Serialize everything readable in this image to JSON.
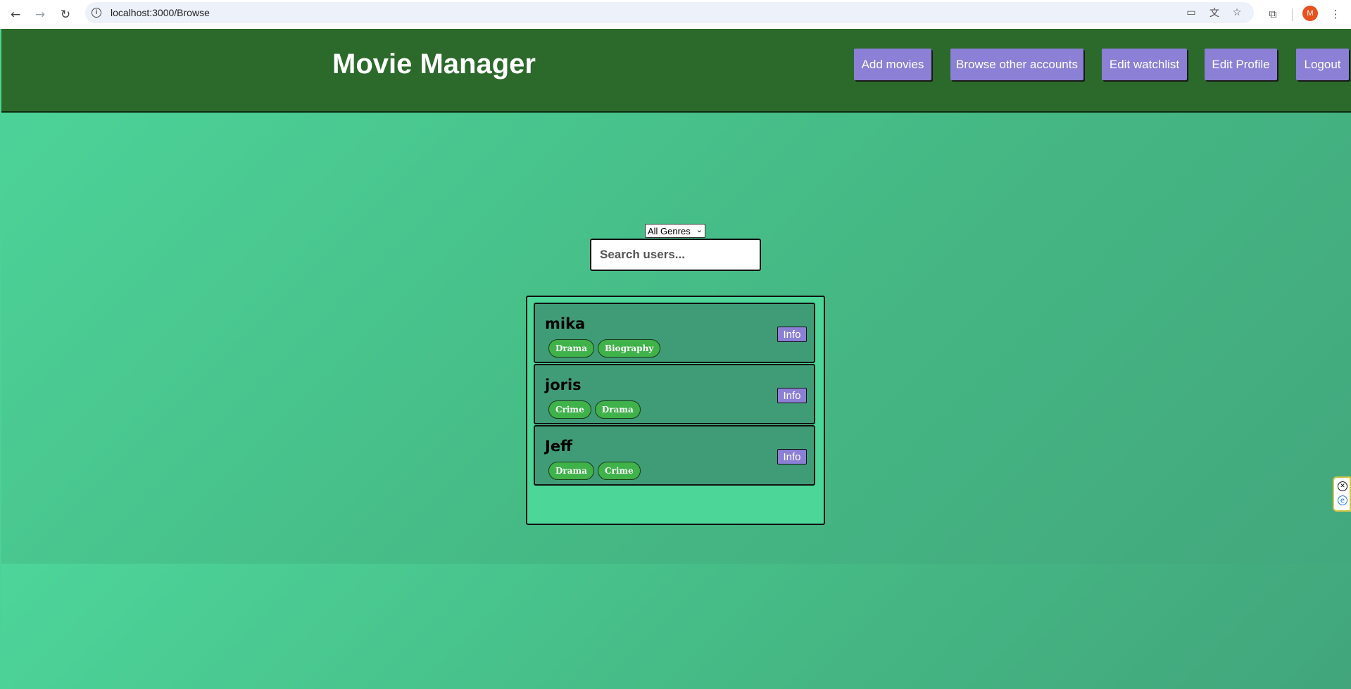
{
  "browser": {
    "url": "localhost:3000/Browse",
    "back_icon": "←",
    "forward_icon": "→",
    "reload_icon": "↻",
    "avatar_letter": "M"
  },
  "header": {
    "title": "Movie Manager",
    "buttons": {
      "add_movies": "Add movies",
      "browse_accounts": "Browse other accounts",
      "edit_watchlist": "Edit watchlist",
      "edit_profile": "Edit Profile",
      "logout": "Logout"
    }
  },
  "filters": {
    "genre_selected": "All Genres",
    "search_placeholder": "Search users..."
  },
  "users": [
    {
      "name": "mika",
      "genres": [
        "Drama",
        "Biography"
      ],
      "info_label": "Info"
    },
    {
      "name": "joris",
      "genres": [
        "Crime",
        "Drama"
      ],
      "info_label": "Info"
    },
    {
      "name": "Jeff",
      "genres": [
        "Drama",
        "Crime"
      ],
      "info_label": "Info"
    }
  ],
  "colors": {
    "header_bg": "#2b6a2b",
    "button_bg": "#8b7fd6",
    "tag_bg": "#3fb24a",
    "card_bg": "#3f9c77",
    "list_bg": "#4cd698"
  }
}
